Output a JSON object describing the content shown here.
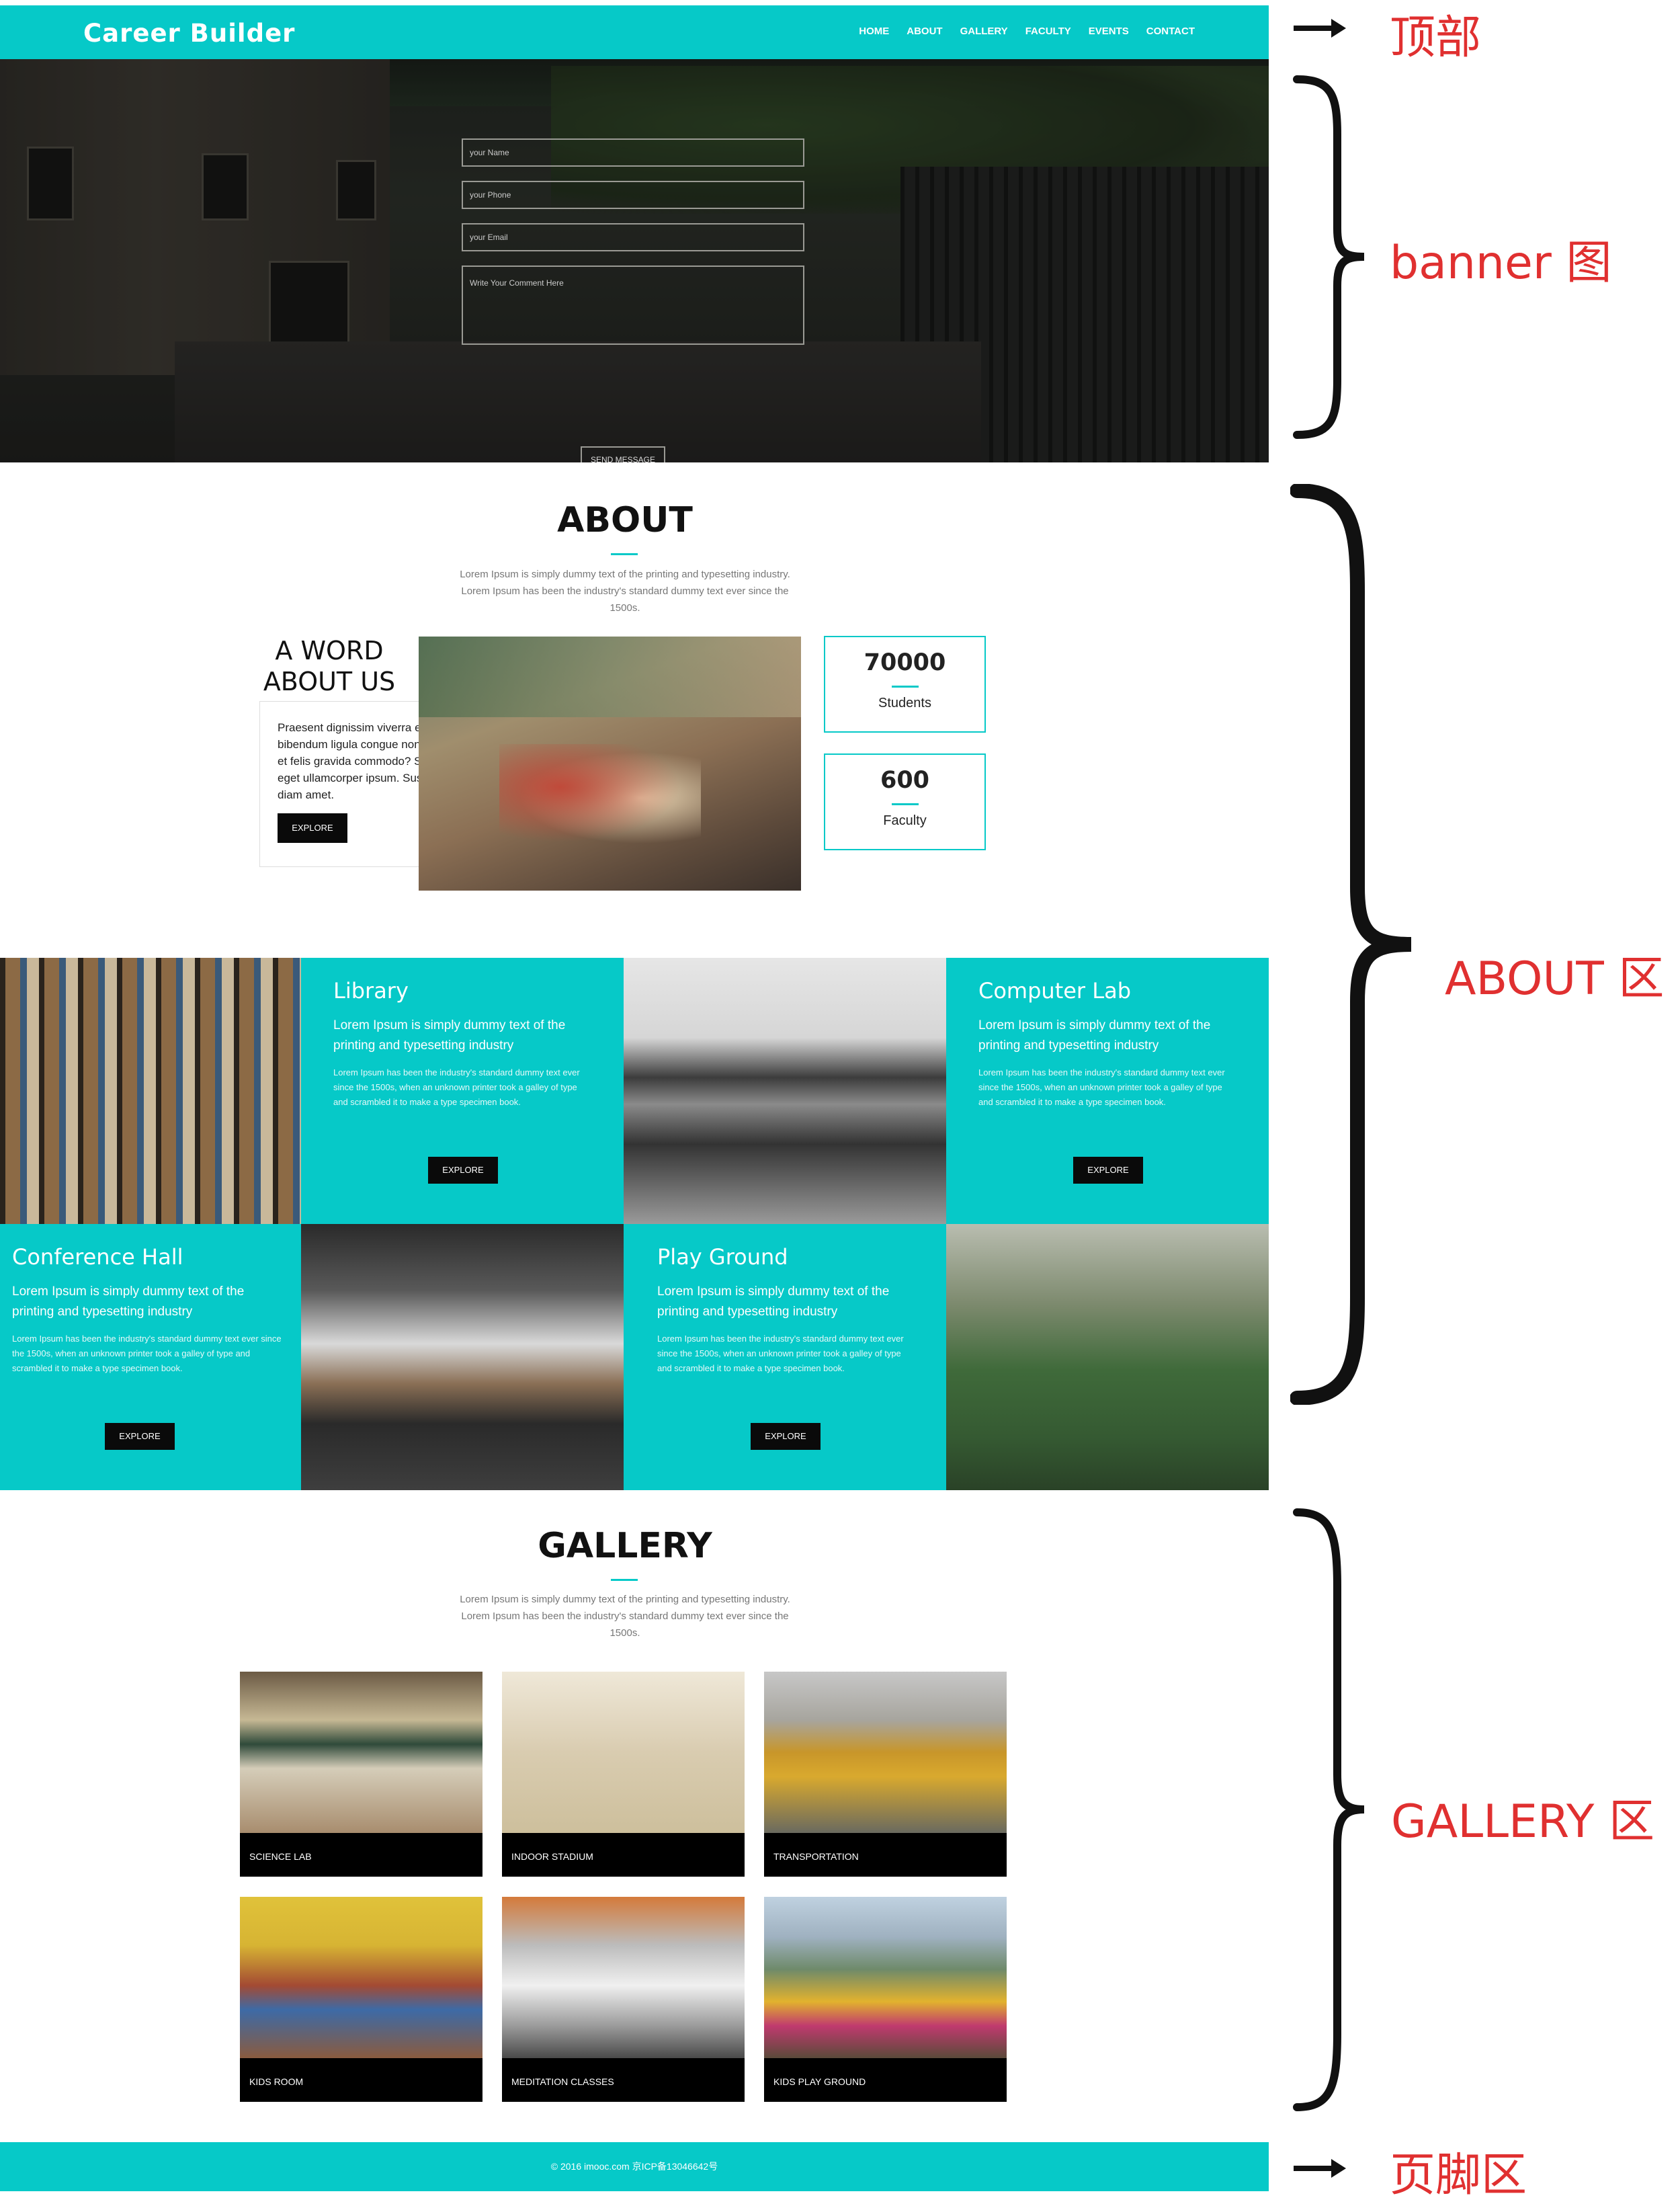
{
  "header": {
    "logo": "Career Builder",
    "nav": [
      "HOME",
      "ABOUT",
      "GALLERY",
      "FACULTY",
      "EVENTS",
      "CONTACT"
    ]
  },
  "banner": {
    "form": {
      "name_placeholder": "your Name",
      "phone_placeholder": "your Phone",
      "email_placeholder": "your Email",
      "comment_placeholder": "Write Your Comment Here",
      "send_label": "SEND MESSAGE"
    }
  },
  "about": {
    "title": "ABOUT",
    "desc": "Lorem Ipsum is simply dummy text of the printing and typesetting industry. Lorem Ipsum has been the industry's standard dummy text ever since the 1500s.",
    "word_heading": "A WORD ABOUT US",
    "word_text": "Praesent dignissim viverra est, sed bibendum ligula congue non. Sed ac nisl et felis gravida commodo? Suspendisse eget ullamcorper ipsum. Suspendisse diam amet.",
    "explore_label": "EXPLORE",
    "stats": [
      {
        "value": "70000",
        "label": "Students"
      },
      {
        "value": "600",
        "label": "Faculty"
      }
    ]
  },
  "facilities": [
    {
      "title": "Library",
      "lead": "Lorem Ipsum is simply dummy text of the printing and typesetting industry",
      "body": "Lorem Ipsum has been the industry's standard dummy text ever since the 1500s, when an unknown printer took a galley of type and scrambled it to make a type specimen book.",
      "button": "EXPLORE"
    },
    {
      "title": "Computer Lab",
      "lead": "Lorem Ipsum is simply dummy text of the printing and typesetting industry",
      "body": "Lorem Ipsum has been the industry's standard dummy text ever since the 1500s, when an unknown printer took a galley of type and scrambled it to make a type specimen book.",
      "button": "EXPLORE"
    },
    {
      "title": "Conference Hall",
      "lead": "Lorem Ipsum is simply dummy text of the printing and typesetting industry",
      "body": "Lorem Ipsum has been the industry's standard dummy text ever since the 1500s, when an unknown printer took a galley of type and scrambled it to make a type specimen book.",
      "button": "EXPLORE"
    },
    {
      "title": "Play Ground",
      "lead": "Lorem Ipsum is simply dummy text of the printing and typesetting industry",
      "body": "Lorem Ipsum has been the industry's standard dummy text ever since the 1500s, when an unknown printer took a galley of type and scrambled it to make a type specimen book.",
      "button": "EXPLORE"
    }
  ],
  "gallery": {
    "title": "GALLERY",
    "desc": "Lorem Ipsum is simply dummy text of the printing and typesetting industry. Lorem Ipsum has been the industry's standard dummy text ever since the 1500s.",
    "items": [
      "SCIENCE LAB",
      "INDOOR STADIUM",
      "TRANSPORTATION",
      "KIDS ROOM",
      "MEDITATION CLASSES",
      "KIDS PLAY GROUND"
    ]
  },
  "footer": {
    "text": "© 2016 imooc.com 京ICP备13046642号"
  },
  "annotations": {
    "top": "顶部",
    "banner": "banner 图",
    "about": "ABOUT 区",
    "gallery": "GALLERY 区",
    "footer": "页脚区"
  },
  "colors": {
    "accent": "#06c9c8",
    "annotation": "#e03030",
    "button": "#0a0a0a"
  }
}
